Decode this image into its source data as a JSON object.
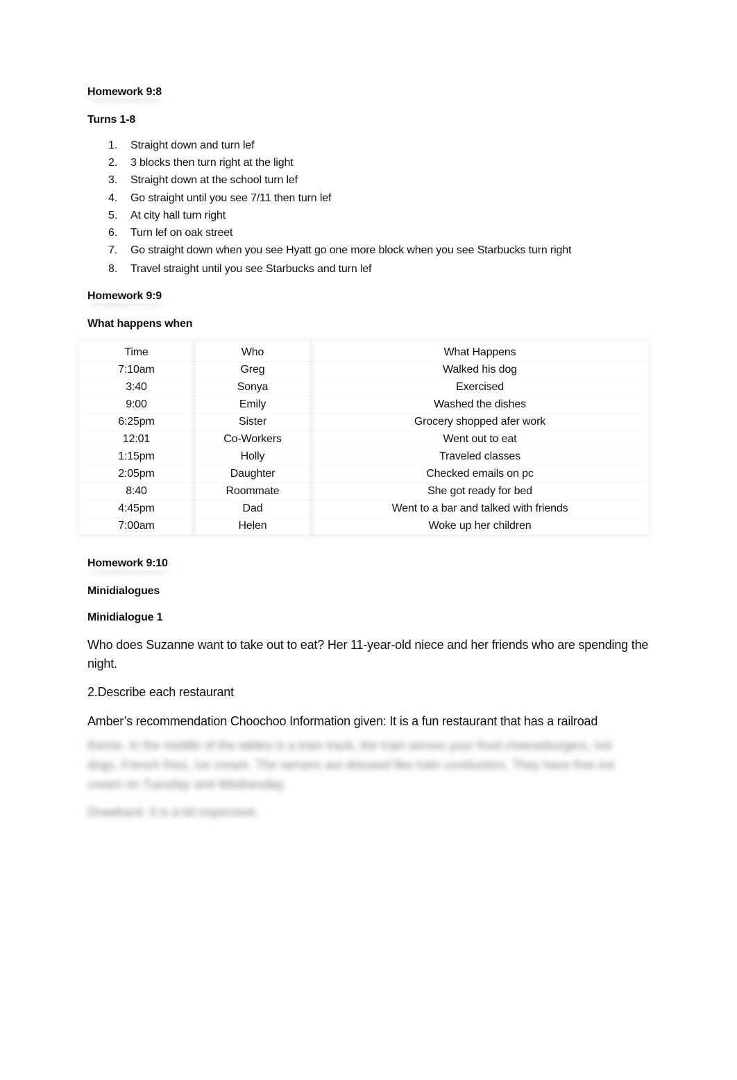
{
  "sections": {
    "hw98": {
      "title": "Homework 9:8",
      "subtitle": "Turns 1-8",
      "turns": [
        {
          "num": "1.",
          "text": "Straight down and turn lef"
        },
        {
          "num": "2.",
          "text": "3 blocks then turn right at the light"
        },
        {
          "num": "3.",
          "text": "Straight down at the school turn lef"
        },
        {
          "num": "4.",
          "text": "Go straight until you see 7/11 then turn lef"
        },
        {
          "num": "5.",
          "text": "At city hall turn right"
        },
        {
          "num": "6.",
          "text": "Turn lef on oak street"
        },
        {
          "num": "7.",
          "text": "Go straight down when you see Hyatt go one more block when you see Starbucks turn right"
        },
        {
          "num": "8.",
          "text": "Travel straight until you see Starbucks and turn lef"
        }
      ]
    },
    "hw99": {
      "title": "Homework 9:9",
      "subtitle": "What happens when",
      "table": {
        "headers": [
          "Time",
          "Who",
          "What Happens"
        ],
        "rows": [
          [
            "7:10am",
            "Greg",
            "Walked his dog"
          ],
          [
            "3:40",
            "Sonya",
            "Exercised"
          ],
          [
            "9:00",
            "Emily",
            "Washed the dishes"
          ],
          [
            "6:25pm",
            "Sister",
            "Grocery shopped afer work"
          ],
          [
            "12:01",
            "Co-Workers",
            "Went out to eat"
          ],
          [
            "1:15pm",
            "Holly",
            "Traveled classes"
          ],
          [
            "2:05pm",
            "Daughter",
            "Checked emails on pc"
          ],
          [
            "8:40",
            "Roommate",
            "She got ready for bed"
          ],
          [
            "4:45pm",
            "Dad",
            "Went to a bar and talked with friends"
          ],
          [
            "7:00am",
            "Helen",
            "Woke up her children"
          ]
        ]
      }
    },
    "hw910": {
      "title": "Homework 9:10",
      "subtitle": "Minidialogues",
      "subsubtitle": "Minidialogue 1",
      "q1": "Who does Suzanne want to take out to eat? Her 11-year-old niece and her friends who are spending the night.",
      "q2": "2.Describe each restaurant",
      "amber": "Amber’s recommendation Choochoo Information given: It is a fun restaurant that has a railroad",
      "blurred_lines": [
        "theme. In the middle of the tables is a train track, the train serves your food cheeseburgers, hot",
        "dogs, French fries, ice cream. The servers are dressed like train conductors. They have free ice",
        "cream on Tuesday and Wednesday.",
        "Drawback: it is a bit expensive."
      ]
    }
  }
}
